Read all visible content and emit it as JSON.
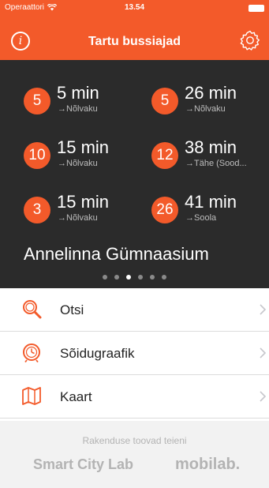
{
  "status_bar": {
    "carrier": "Operaattori",
    "time": "13.54"
  },
  "header": {
    "title": "Tartu bussiajad",
    "info_label": "i"
  },
  "departures": [
    {
      "route": "5",
      "time": "5 min",
      "destination": "→Nõlvaku"
    },
    {
      "route": "5",
      "time": "26 min",
      "destination": "→Nõlvaku"
    },
    {
      "route": "10",
      "time": "15 min",
      "destination": "→Nõlvaku"
    },
    {
      "route": "12",
      "time": "38 min",
      "destination": "→Tähe (Sood..."
    },
    {
      "route": "3",
      "time": "15 min",
      "destination": "→Nõlvaku"
    },
    {
      "route": "26",
      "time": "41 min",
      "destination": "→Soola"
    }
  ],
  "stop": {
    "name": "Annelinna Gümnaasium"
  },
  "pager": {
    "count": 6,
    "active_index": 2
  },
  "menu": [
    {
      "label": "Otsi",
      "icon": "search-icon"
    },
    {
      "label": "Sõidugraafik",
      "icon": "clock-icon"
    },
    {
      "label": "Kaart",
      "icon": "map-icon"
    }
  ],
  "footer": {
    "caption": "Rakenduse toovad teieni",
    "logo_left": "Smart City Lab",
    "logo_right": "mobilab."
  },
  "colors": {
    "accent": "#f35a2a",
    "dark_panel": "#2b2b2b",
    "footer_bg": "#f2f2f2"
  }
}
